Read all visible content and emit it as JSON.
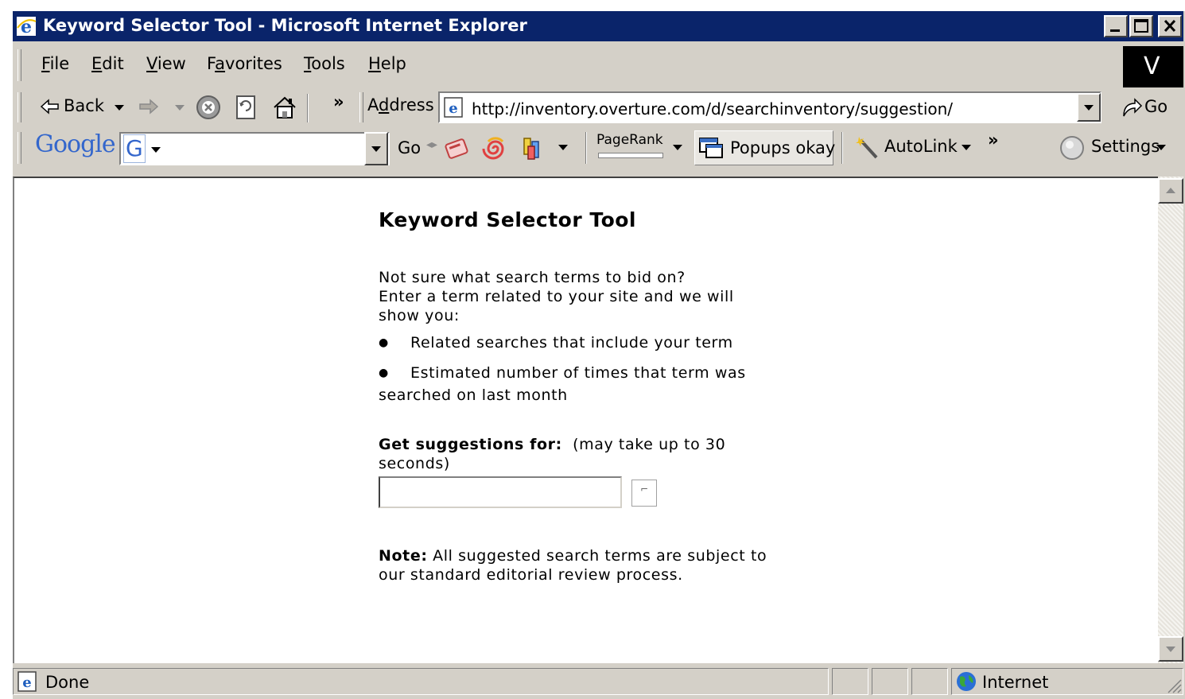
{
  "window": {
    "title": "Keyword Selector Tool - Microsoft Internet Explorer"
  },
  "menu": {
    "items": [
      {
        "pre": "",
        "key": "F",
        "post": "ile"
      },
      {
        "pre": "",
        "key": "E",
        "post": "dit"
      },
      {
        "pre": "",
        "key": "V",
        "post": "iew"
      },
      {
        "pre": "F",
        "key": "a",
        "post": "vorites"
      },
      {
        "pre": "",
        "key": "T",
        "post": "ools"
      },
      {
        "pre": "",
        "key": "H",
        "post": "elp"
      }
    ],
    "brand_letter": "V"
  },
  "toolbar": {
    "back_label": "Back",
    "more_glyph": "»",
    "address_pre": "A",
    "address_key": "d",
    "address_post": "dress",
    "url": "http://inventory.overture.com/d/searchinventory/suggestion/",
    "go_label": "Go"
  },
  "google_bar": {
    "logo": "Google",
    "g_letter": "G",
    "go_label": "Go",
    "pagerank_label": "PageRank",
    "popups_label": "Popups okay",
    "autolink_label": "AutoLink",
    "more_glyph": "»",
    "settings_label": "Settings"
  },
  "page": {
    "heading": "Keyword Selector Tool",
    "intro_line1": "Not sure what search terms to bid on?",
    "intro_line2": "Enter a term related to your site and we will show you:",
    "bullet1": "Related searches that include your term",
    "bullet2": "Estimated number of times that term was",
    "bullet2_cont": "searched on last month",
    "suggest_bold": "Get suggestions for:",
    "suggest_note": "(may take up to 30 seconds)",
    "search_value": "",
    "note_bold": "Note:",
    "note_text": "All suggested search terms are subject to our standard editorial review process."
  },
  "status": {
    "text": "Done",
    "zone": "Internet"
  },
  "colors": {
    "titlebar": "#0a246a",
    "chrome": "#d4d0c8",
    "google_blue": "#3366cc",
    "google_red": "#cc3333"
  }
}
